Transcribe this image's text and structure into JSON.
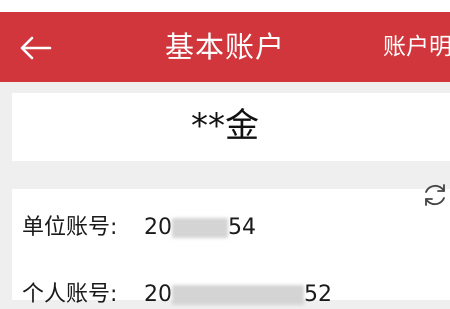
{
  "header": {
    "title": "基本账户",
    "detail_link": "账户明细",
    "back_icon": "arrow-left-icon",
    "color": "#d0363b"
  },
  "account_name": "**金",
  "refresh_icon": "refresh-icon",
  "rows": [
    {
      "label": "单位账号:",
      "value_prefix": "20",
      "value_suffix": "54"
    },
    {
      "label": "个人账号:",
      "value_prefix": "20",
      "value_suffix": "52"
    }
  ]
}
